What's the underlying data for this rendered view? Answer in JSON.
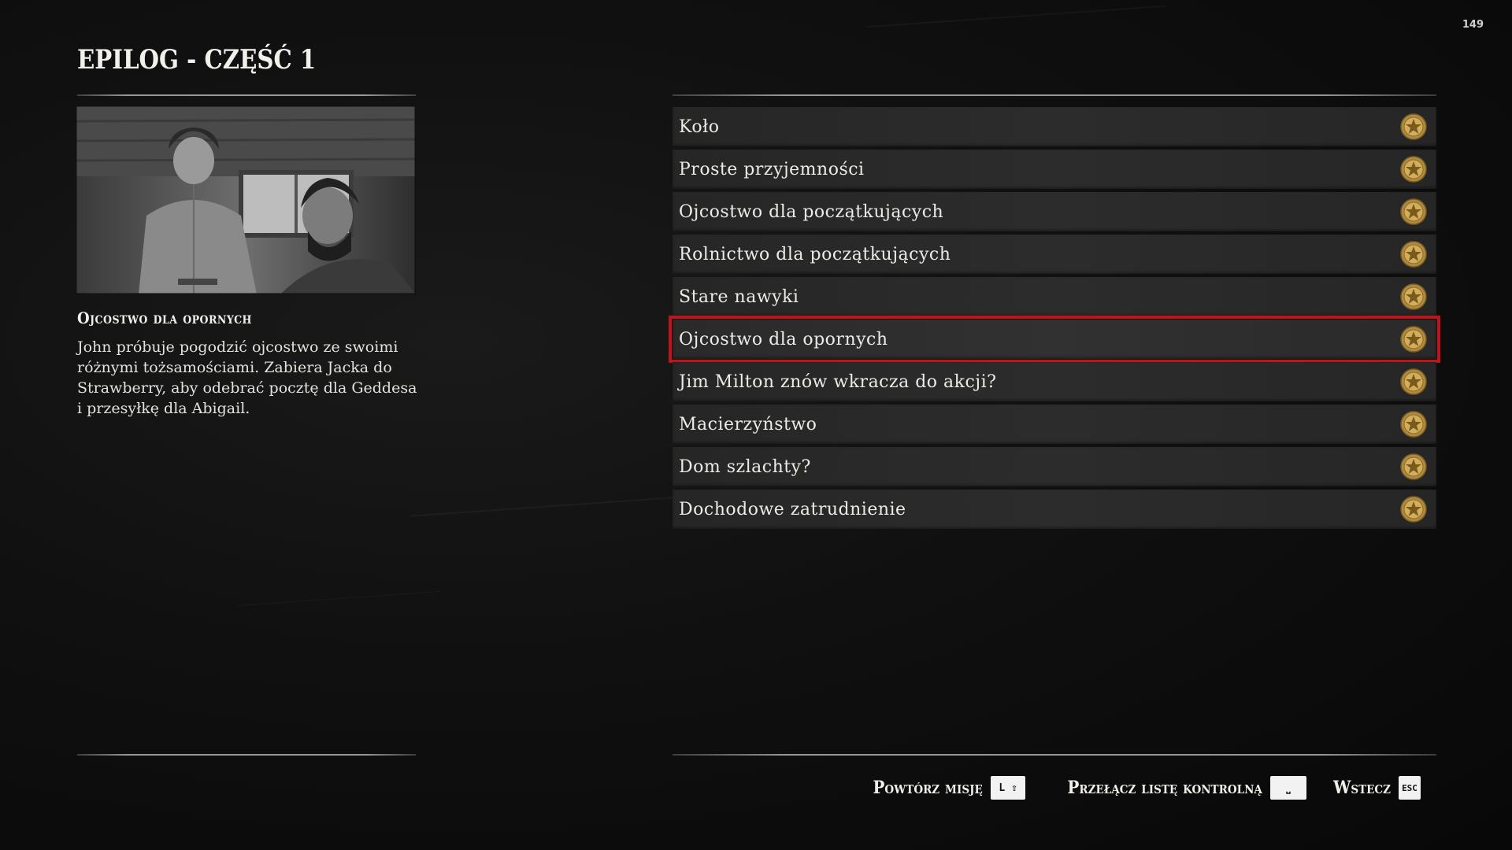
{
  "counter": "149",
  "header": {
    "title": "EPILOG - CZĘŚĆ 1"
  },
  "details": {
    "mission_title": "Ojcostwo dla opornych",
    "description": "John próbuje pogodzić ojcostwo ze swoimi różnymi tożsamościami. Zabiera Jacka do Strawberry, aby odebrać pocztę dla Geddesa i przesyłkę dla Abigail."
  },
  "missions": [
    {
      "label": "Koło",
      "medal": "gold-medal-icon"
    },
    {
      "label": "Proste przyjemności",
      "medal": "gold-medal-icon"
    },
    {
      "label": "Ojcostwo dla początkujących",
      "medal": "gold-medal-icon"
    },
    {
      "label": "Rolnictwo dla początkujących",
      "medal": "gold-medal-icon"
    },
    {
      "label": "Stare nawyki",
      "medal": "gold-medal-icon"
    },
    {
      "label": "Ojcostwo dla opornych",
      "medal": "gold-medal-icon",
      "selected": true
    },
    {
      "label": "Jim Milton znów wkracza do akcji?",
      "medal": "gold-medal-icon"
    },
    {
      "label": "Macierzyństwo",
      "medal": "gold-medal-icon"
    },
    {
      "label": "Dom szlachty?",
      "medal": "gold-medal-icon"
    },
    {
      "label": "Dochodowe zatrudnienie",
      "medal": "gold-medal-icon"
    }
  ],
  "footer": {
    "replay_label": "Powtórz misję",
    "replay_key": "L ⇧",
    "toggle_label": "Przełącz listę kontrolną",
    "toggle_key": "⎵",
    "back_label": "Wstecz",
    "back_key": "ESC"
  },
  "colors": {
    "selection": "#c0141a",
    "medal_gold": "#c9a04a"
  }
}
